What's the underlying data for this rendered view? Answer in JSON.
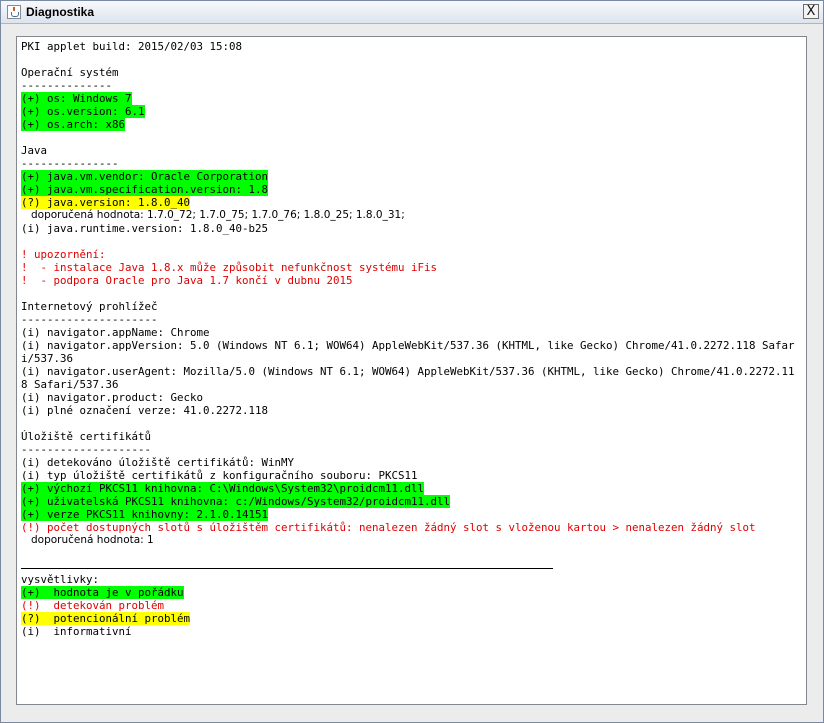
{
  "window": {
    "title": "Diagnostika",
    "close_glyph": "X"
  },
  "lines": {
    "build": "PKI applet build: 2015/02/03 15:08",
    "os_header": "Operační systém",
    "os_rule": "--------------",
    "os_name": "(+) os: Windows 7",
    "os_version": "(+) os.version: 6.1",
    "os_arch": "(+) os.arch: x86",
    "java_header": "Java",
    "java_rule": "---------------",
    "java_vendor": "(+) java.vm.vendor: Oracle Corporation",
    "java_spec": "(+) java.vm.specification.version: 1.8",
    "java_version": "(?) java.version: 1.8.0_40",
    "java_recommended": "doporučená hodnota: 1.7.0_72; 1.7.0_75; 1.7.0_76; 1.8.0_25; 1.8.0_31;",
    "java_runtime": "(i) java.runtime.version: 1.8.0_40-b25",
    "warn_title": "! upozornění:",
    "warn_1": "!  - instalace Java 1.8.x může způsobit nefunkčnost systému iFis",
    "warn_2": "!  - podpora Oracle pro Java 1.7 končí v dubnu 2015",
    "browser_header": "Internetový prohlížeč",
    "browser_rule": "---------------------",
    "browser_appname": "(i) navigator.appName: Chrome",
    "browser_appversion": "(i) navigator.appVersion: 5.0 (Windows NT 6.1; WOW64) AppleWebKit/537.36 (KHTML, like Gecko) Chrome/41.0.2272.118 Safari/537.36",
    "browser_useragent": "(i) navigator.userAgent: Mozilla/5.0 (Windows NT 6.1; WOW64) AppleWebKit/537.36 (KHTML, like Gecko) Chrome/41.0.2272.118 Safari/537.36",
    "browser_product": "(i) navigator.product: Gecko",
    "browser_fullversion": "(i) plné označení verze: 41.0.2272.118",
    "store_header": "Úložiště certifikátů",
    "store_rule": "--------------------",
    "store_detected": "(i) detekováno úložiště certifikátů: WinMY",
    "store_type": "(i) typ úložiště certifikátů z konfiguračního souboru: PKCS11",
    "store_default_lib": "(+) výchozí PKCS11 knihovna: C:\\Windows\\System32\\proidcm11.dll",
    "store_user_lib": "(+) uživatelská PKCS11 knihovna: c:/Windows/System32/proidcm11.dll",
    "store_lib_version": "(+) verze PKCS11 knihovny: 2.1.0.14151",
    "store_slots": "(!) počet dostupných slotů s úložištěm certifikátů: nenalezen žádný slot s vloženou kartou > nenalezen žádný slot",
    "store_recommended": "doporučená hodnota: 1"
  },
  "legend": {
    "title": "vysvětlivky:",
    "ok": "(+)  hodnota je v pořádku",
    "error": "(!)  detekován problém",
    "warning": "(?)  potencionální problém",
    "info": "(i)  informativní"
  },
  "colors": {
    "ok_highlight": "#00ff00",
    "warning_highlight": "#ffff00",
    "error_text": "#e00000"
  }
}
